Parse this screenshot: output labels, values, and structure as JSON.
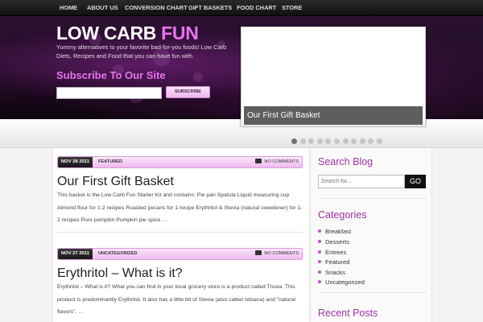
{
  "nav": {
    "items": [
      "HOME",
      "ABOUT US",
      "CONVERSION CHART",
      "GIFT BASKETS",
      "FOOD CHART",
      "STORE"
    ]
  },
  "header": {
    "title_main": "LOW CARB",
    "title_accent": "FUN",
    "tagline": "Yummy alternatives to your favorite bad-for-you foods! Low Carb Diets, Recipes and Food that you can have fun with.",
    "subscribe_heading": "Subscribe To Our Site",
    "subscribe_input_value": "",
    "subscribe_button": "SUBSCRIBE"
  },
  "slider": {
    "caption": "Our First Gift Basket",
    "dot_count": 11,
    "active_dot": 1
  },
  "posts": [
    {
      "date": "NOV 28 2011",
      "category": "FEATURED",
      "comments": "NO COMMENTS",
      "title": "Our First Gift Basket",
      "excerpt": "This basket is the Low Carb Fun Starter Kit and contains: Pie pan Spatula Liquid measuring cup Almond flour for 1-2 recipes Roasted pecans for 1 recipe Erythritol & Stevia (natural sweetener) for 1-2 recipes Pure pumpkin Pumpkin pie spice …"
    },
    {
      "date": "NOV 27 2011",
      "category": "UNCATEGORIZED",
      "comments": "NO COMMENTS",
      "title": "Erythritol – What is it?",
      "excerpt": "Erythritol – What is it?      What you can find in your local grocery store is a product called Truvia. This product is predominantly Erythritol.  It also has a little bit of Stevia (also called rebiana) and \"natural flavors\". …"
    }
  ],
  "sidebar": {
    "search_title": "Search Blog",
    "search_placeholder": "Search for...",
    "search_button": "GO",
    "categories_title": "Categories",
    "categories": [
      "Breakfast",
      "Desserts",
      "Entrees",
      "Featured",
      "Snacks",
      "Uncategorized"
    ],
    "recent_title": "Recent Posts"
  },
  "colors": {
    "accent": "#e774ee",
    "widget_title": "#a034a8",
    "meta_bar": "#f0b8f0"
  },
  "icons": [
    "comment-icon",
    "bullet-icon"
  ]
}
